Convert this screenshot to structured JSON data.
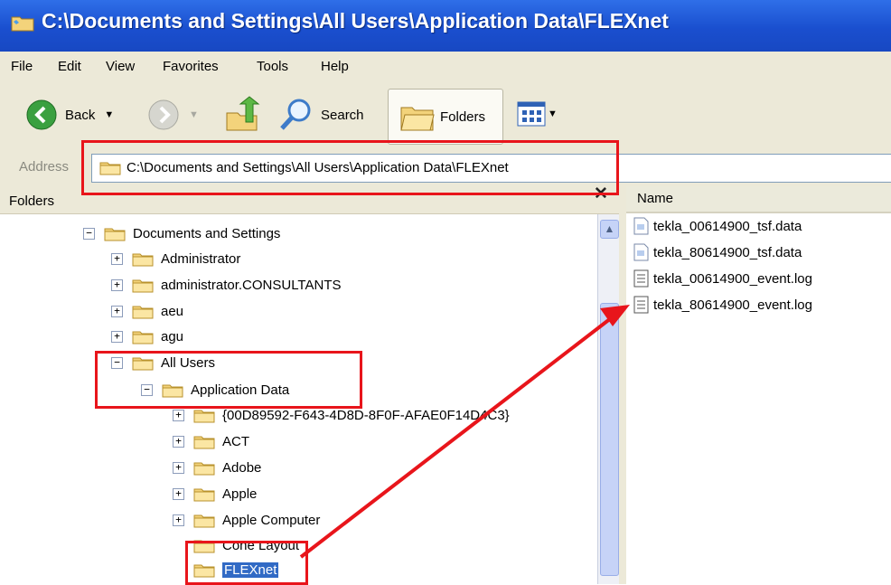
{
  "window": {
    "title": "C:\\Documents and Settings\\All Users\\Application Data\\FLEXnet"
  },
  "menu": [
    "File",
    "Edit",
    "View",
    "Favorites",
    "Tools",
    "Help"
  ],
  "toolbar": {
    "back_label": "Back",
    "search_label": "Search",
    "folders_label": "Folders"
  },
  "address": {
    "label": "Address",
    "value": "C:\\Documents and Settings\\All Users\\Application Data\\FLEXnet"
  },
  "folders_pane": {
    "title": "Folders",
    "close_glyph": "✕"
  },
  "tree": [
    {
      "label": "Documents and Settings",
      "expander": "−"
    },
    {
      "label": "Administrator",
      "expander": "+"
    },
    {
      "label": "administrator.CONSULTANTS",
      "expander": "+"
    },
    {
      "label": "aeu",
      "expander": "+"
    },
    {
      "label": "agu",
      "expander": "+"
    },
    {
      "label": "All Users",
      "expander": "−"
    },
    {
      "label": "Application Data",
      "expander": "−"
    },
    {
      "label": "{00D89592-F643-4D8D-8F0F-AFAE0F14D4C3}",
      "expander": "+"
    },
    {
      "label": "ACT",
      "expander": "+"
    },
    {
      "label": "Adobe",
      "expander": "+"
    },
    {
      "label": "Apple",
      "expander": "+"
    },
    {
      "label": "Apple Computer",
      "expander": "+"
    },
    {
      "label": "Cone Layout",
      "expander": ""
    },
    {
      "label": "FLEXnet",
      "expander": ""
    }
  ],
  "files": {
    "column_name": "Name",
    "items": [
      {
        "name": "tekla_00614900_tsf.data",
        "icon": "data-file-icon"
      },
      {
        "name": "tekla_80614900_tsf.data",
        "icon": "data-file-icon"
      },
      {
        "name": "tekla_00614900_event.log",
        "icon": "log-file-icon"
      },
      {
        "name": "tekla_80614900_event.log",
        "icon": "log-file-icon"
      }
    ]
  },
  "colors": {
    "titlebar": "#1a4fcf",
    "highlight": "#e8151b",
    "selection": "#316ac5"
  }
}
